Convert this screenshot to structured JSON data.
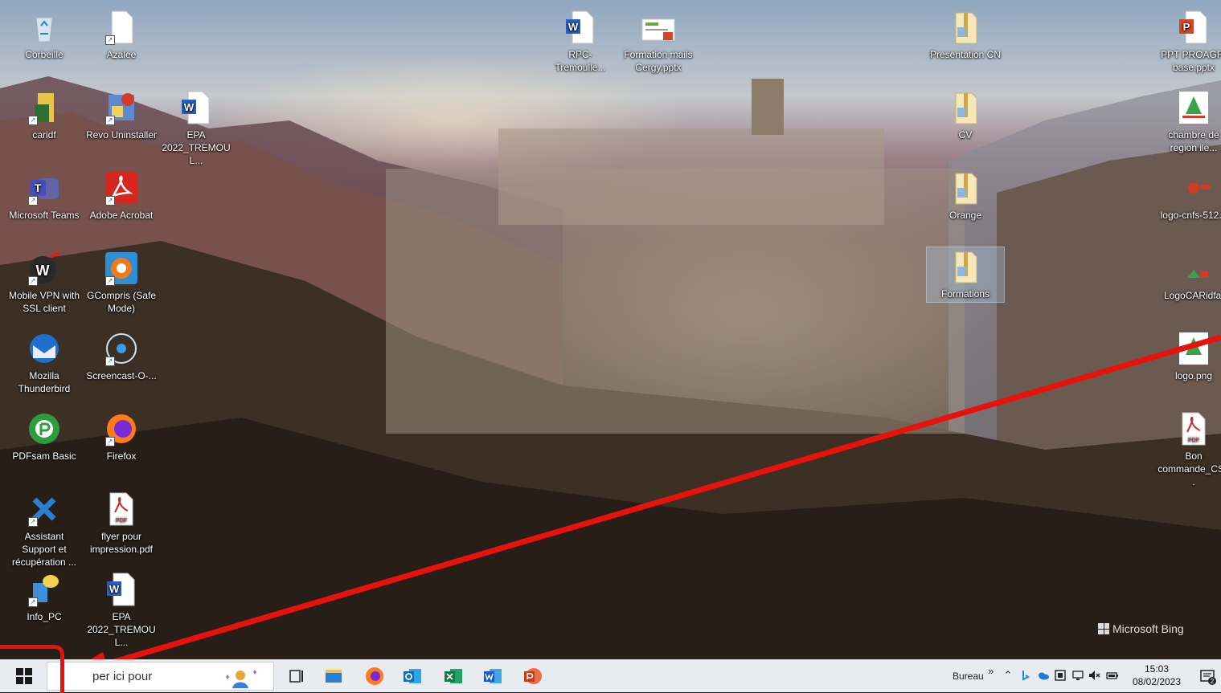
{
  "desktop": {
    "icons": [
      {
        "label": "Corbeille",
        "icon": "recycle-bin-icon"
      },
      {
        "label": "Azalee",
        "icon": "blank-file-icon"
      },
      {
        "label": "caridf",
        "icon": "folder-icon"
      },
      {
        "label": "Revo Uninstaller",
        "icon": "revo-uninstaller-icon"
      },
      {
        "label": "EPA 2022_TREMOUL...",
        "icon": "word-document-icon"
      },
      {
        "label": "Microsoft Teams",
        "icon": "teams-icon"
      },
      {
        "label": "Adobe Acrobat",
        "icon": "acrobat-icon"
      },
      {
        "label": "Mobile VPN with SSL client",
        "icon": "vpn-icon"
      },
      {
        "label": "GCompris (Safe Mode)",
        "icon": "gcompris-icon"
      },
      {
        "label": "Mozilla Thunderbird",
        "icon": "thunderbird-icon"
      },
      {
        "label": "Screencast-O-...",
        "icon": "screencast-icon"
      },
      {
        "label": "PDFsam Basic",
        "icon": "pdfsam-icon"
      },
      {
        "label": "Firefox",
        "icon": "firefox-icon"
      },
      {
        "label": "Assistant Support et récupération ...",
        "icon": "support-tools-icon"
      },
      {
        "label": "flyer pour impression.pdf",
        "icon": "pdf-file-icon"
      },
      {
        "label": "Info_PC",
        "icon": "info-pc-icon"
      },
      {
        "label": "EPA 2022_TREMOUL...",
        "icon": "word-document-icon"
      },
      {
        "label": "RPC-Tremoulle...",
        "icon": "word-document-icon"
      },
      {
        "label": "Formation mails Cergy.pptx",
        "icon": "pptx-thumbnail-icon"
      },
      {
        "label": "Presentation CN",
        "icon": "zip-folder-icon"
      },
      {
        "label": "CV",
        "icon": "zip-folder-icon"
      },
      {
        "label": "Orange",
        "icon": "zip-folder-icon"
      },
      {
        "label": "Formations",
        "icon": "zip-folder-icon"
      },
      {
        "label": "PPT PROAGRI base.pptx",
        "icon": "powerpoint-file-icon"
      },
      {
        "label": "chambre de region ile...",
        "icon": "image-file-icon"
      },
      {
        "label": "logo-cnfs-512...",
        "icon": "image-file-icon"
      },
      {
        "label": "LogoCARidfal",
        "icon": "image-file-icon"
      },
      {
        "label": "logo.png",
        "icon": "image-file-icon"
      },
      {
        "label": "Bon commande_CS...",
        "icon": "pdf-file-icon"
      }
    ],
    "watermark": "Microsoft Bing"
  },
  "taskbar": {
    "search_placeholder": "per ici pour",
    "apps": [
      "file-explorer-icon",
      "firefox-icon",
      "outlook-icon",
      "excel-icon",
      "word-icon",
      "powerpoint-icon"
    ],
    "toolbar_label": "Bureau",
    "toolbar_chevron": "»",
    "time": "15:03",
    "date": "08/02/2023",
    "notifications_count": "2"
  },
  "annotation_color": "#e8120c"
}
